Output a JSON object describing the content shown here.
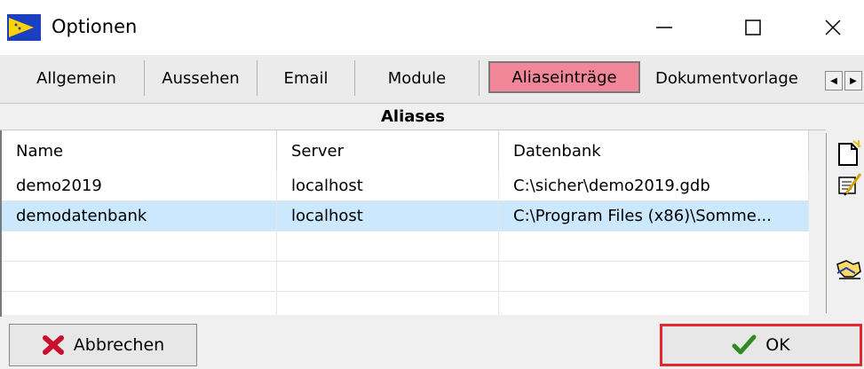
{
  "window": {
    "title": "Optionen"
  },
  "tabs": [
    {
      "label": "Allgemein"
    },
    {
      "label": "Aussehen"
    },
    {
      "label": "Email"
    },
    {
      "label": "Module"
    },
    {
      "label": "Aliaseinträge",
      "active": true
    },
    {
      "label": "Dokumentvorlage"
    }
  ],
  "grid": {
    "title": "Aliases",
    "columns": [
      "Name",
      "Server",
      "Datenbank"
    ],
    "rows": [
      [
        "demo2019",
        "localhost",
        "C:\\sicher\\demo2019.gdb"
      ],
      [
        "demodatenbank",
        "localhost",
        "C:\\Program Files (x86)\\Somme..."
      ]
    ],
    "selected_row": 1
  },
  "side_icons": [
    "new-document-icon",
    "edit-icon",
    "handshake-icon"
  ],
  "buttons": {
    "cancel": "Abbrechen",
    "ok": "OK"
  },
  "colors": {
    "active_tab": "#f3879a",
    "selected_row": "#cce8ff",
    "ok_highlight": "#e3262f"
  }
}
